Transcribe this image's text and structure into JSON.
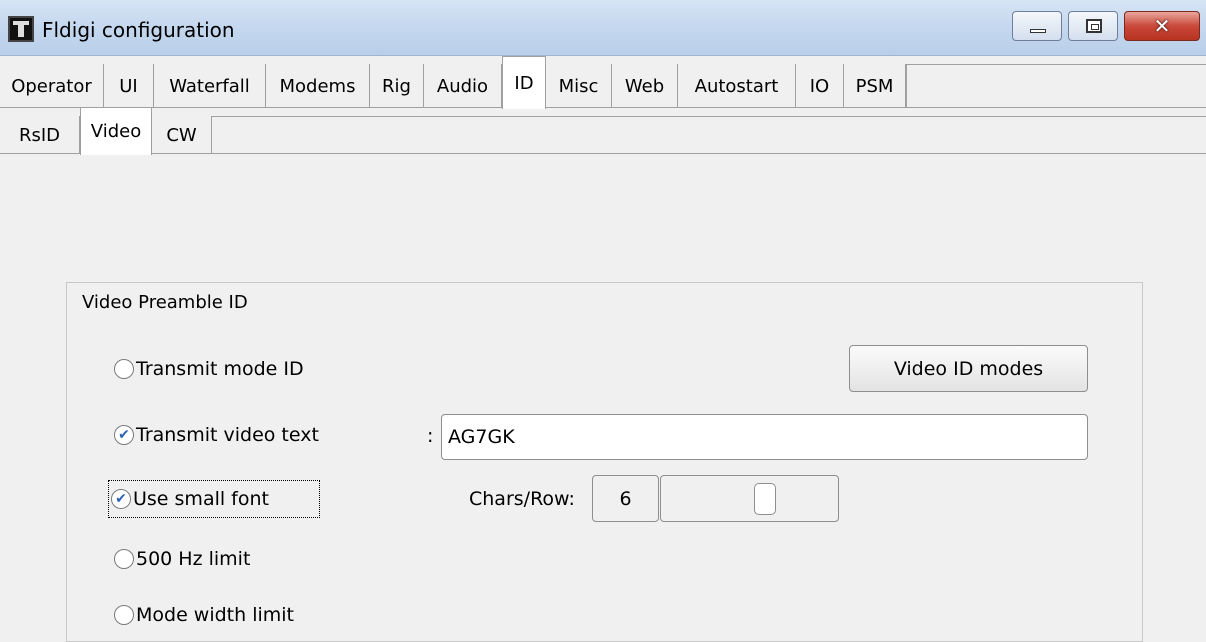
{
  "window": {
    "title": "Fldigi configuration",
    "close_glyph": "✕"
  },
  "tabs": [
    "Operator",
    "UI",
    "Waterfall",
    "Modems",
    "Rig",
    "Audio",
    "ID",
    "Misc",
    "Web",
    "Autostart",
    "IO",
    "PSM"
  ],
  "active_tab": "ID",
  "subtabs": [
    "RsID",
    "Video",
    "CW"
  ],
  "active_subtab": "Video",
  "group": {
    "title": "Video Preamble ID",
    "transmit_mode_id": {
      "label": "Transmit mode ID",
      "checked": false
    },
    "video_id_modes_button": "Video ID modes",
    "transmit_video_text": {
      "label": "Transmit video text",
      "checked": true
    },
    "video_text_separator": ":",
    "video_text_value": "AG7GK",
    "use_small_font": {
      "label": "Use small font",
      "checked": true
    },
    "chars_row": {
      "label": "Chars/Row:",
      "value": "6",
      "level": 0.6
    },
    "limit_500hz": {
      "label": "500 Hz limit",
      "checked": false
    },
    "mode_width_limit": {
      "label": "Mode width limit",
      "checked": false
    }
  },
  "check_glyph": "✔"
}
